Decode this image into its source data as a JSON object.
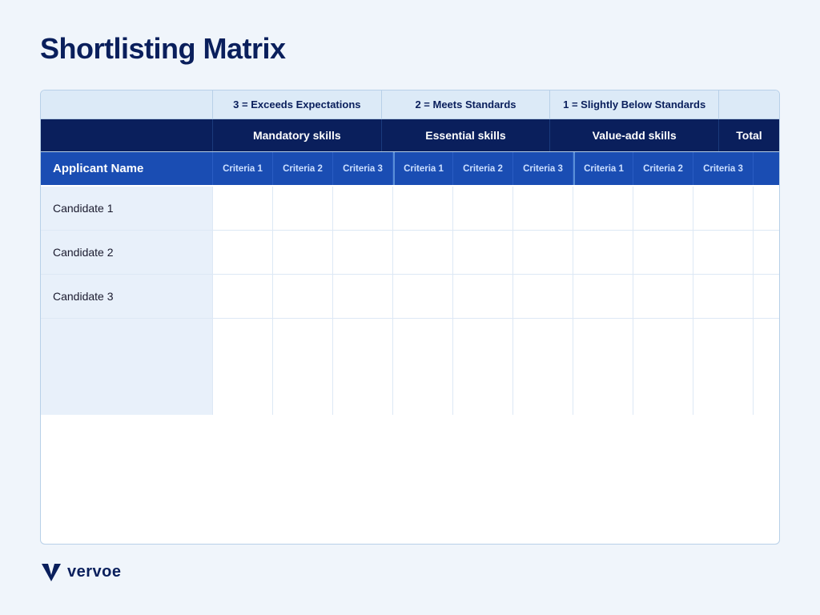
{
  "page": {
    "title": "Shortlisting Matrix"
  },
  "legend": {
    "empty": "",
    "cell1": "3 = Exceeds Expectations",
    "cell2": "2 = Meets Standards",
    "cell3": "1 = Slightly Below Standards",
    "total": ""
  },
  "skills": {
    "empty": "",
    "mandatory": "Mandatory skills",
    "essential": "Essential skills",
    "valueadd": "Value-add skills",
    "total": "Total"
  },
  "criteria_row": {
    "applicant_name": "Applicant Name",
    "criteria": [
      "Criteria 1",
      "Criteria 2",
      "Criteria 3",
      "Criteria 1",
      "Criteria 2",
      "Criteria 3",
      "Criteria 1",
      "Criteria 2",
      "Criteria 3"
    ]
  },
  "candidates": [
    {
      "name": "Candidate 1"
    },
    {
      "name": "Candidate 2"
    },
    {
      "name": "Candidate 3"
    }
  ],
  "footer": {
    "brand": "vervoe"
  }
}
